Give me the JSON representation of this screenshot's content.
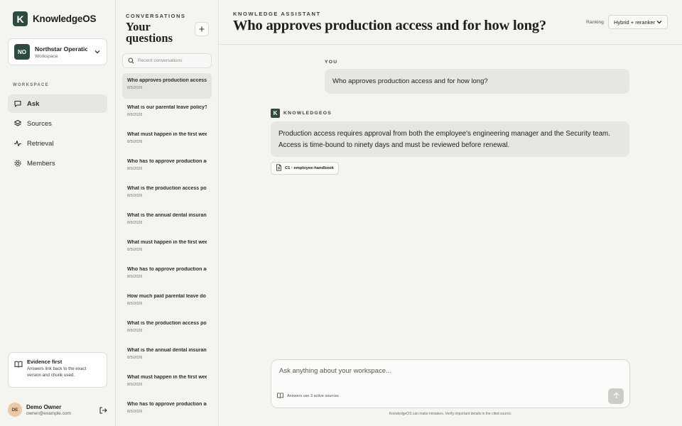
{
  "app": {
    "name": "KnowledgeOS",
    "logo_letter": "K",
    "accent_color": "#2f4a40"
  },
  "workspace": {
    "initials": "NO",
    "name": "Northstar Operations",
    "type": "Workspace"
  },
  "sidebar": {
    "section_label": "WORKSPACE",
    "items": [
      {
        "label": "Ask",
        "icon": "chat-bubble-icon",
        "active": true
      },
      {
        "label": "Sources",
        "icon": "layers-icon",
        "active": false
      },
      {
        "label": "Retrieval",
        "icon": "pulse-icon",
        "active": false
      },
      {
        "label": "Members",
        "icon": "gear-icon",
        "active": false
      }
    ]
  },
  "evidence_card": {
    "title": "Evidence first",
    "body": "Answers link back to the exact version and chunk used."
  },
  "user": {
    "initials": "DE",
    "name": "Demo Owner",
    "email": "owner@example.com"
  },
  "conversations": {
    "eyebrow": "CONVERSATIONS",
    "title": "Your questions",
    "search_placeholder": "Recent conversations",
    "items": [
      {
        "question": "Who approves production access and for how long?",
        "date": "8/5/2026",
        "active": true
      },
      {
        "question": "What is our parental leave policy?",
        "date": "8/5/2026"
      },
      {
        "question": "What must happen in the first week?",
        "date": "8/5/2026"
      },
      {
        "question": "Who has to approve production access?",
        "date": "8/5/2026"
      },
      {
        "question": "What is the production access policy?",
        "date": "8/5/2026"
      },
      {
        "question": "What is the annual dental insurance limit?",
        "date": "8/5/2026"
      },
      {
        "question": "What must happen in the first week?",
        "date": "8/5/2026"
      },
      {
        "question": "Who has to approve production access?",
        "date": "8/5/2026"
      },
      {
        "question": "How much paid parental leave do we offer?",
        "date": "8/5/2026"
      },
      {
        "question": "What is the production access policy?",
        "date": "8/5/2026"
      },
      {
        "question": "What is the annual dental insurance limit?",
        "date": "8/5/2026"
      },
      {
        "question": "What must happen in the first week?",
        "date": "8/5/2026"
      },
      {
        "question": "Who has to approve production access?",
        "date": "8/5/2026"
      }
    ]
  },
  "main": {
    "eyebrow": "KNOWLEDGE ASSISTANT",
    "title": "Who approves production access and for how long?",
    "ranking_label": "Ranking",
    "ranking_value": "Hybrid + reranker",
    "you_label": "YOU",
    "user_message": "Who approves production access and for how long?",
    "assistant_label": "KNOWLEDGEOS",
    "answer": "Production access requires approval from both the employee's engineering manager and the Security team. Access is time-bound to ninety days and must be reviewed before renewal.",
    "citation": "C1 · employee-handbook"
  },
  "composer": {
    "placeholder": "Ask anything about your workspace...",
    "sources_note": "Answers use 3 active sources",
    "disclaimer": "KnowledgeOS can make mistakes. Verify important details in the cited source."
  }
}
